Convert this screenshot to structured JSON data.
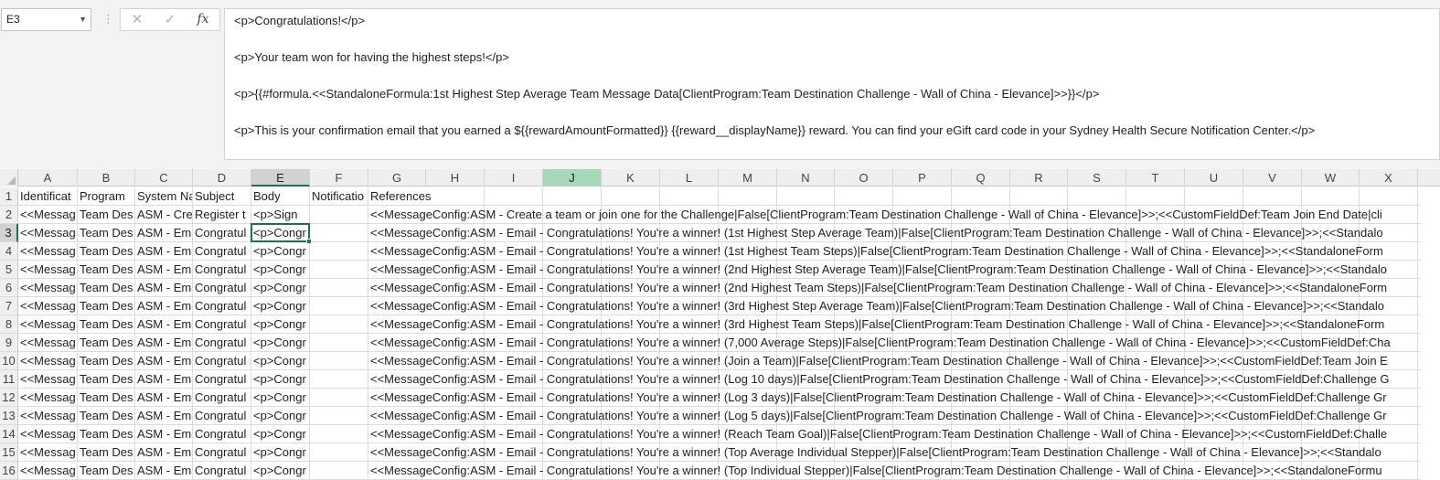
{
  "formula_bar": {
    "name_box": "E3",
    "fx_label": "fx",
    "cancel_icon": "close-icon",
    "enter_icon": "check-icon",
    "content_lines": [
      "<p>Congratulations!</p>",
      "",
      "<p>Your team won for having the highest steps!</p>",
      "",
      "<p>{{#formula.<<StandaloneFormula:1st Highest Step Average Team Message Data[ClientProgram:Team Destination Challenge - Wall of China - Elevance]>>}}</p>",
      "",
      "<p>This is your confirmation email that you earned a ${{rewardAmountFormatted}} {{reward__displayName}} reward. You can find your eGift card code in your Sydney Health Secure Notification Center.</p>"
    ]
  },
  "columns": [
    "A",
    "B",
    "C",
    "D",
    "E",
    "F",
    "G",
    "H",
    "I",
    "J",
    "K",
    "L",
    "M",
    "N",
    "O",
    "P",
    "Q",
    "R",
    "S",
    "T",
    "U",
    "V",
    "W",
    "X"
  ],
  "selected_column": "E",
  "highlighted_column": "J",
  "selected_row": "3",
  "rows": [
    {
      "num": "1",
      "A": "Identificat",
      "B": "Program",
      "C": "System Na",
      "D": "Subject",
      "E": "Body",
      "F": "Notificatio",
      "G": "References"
    },
    {
      "num": "2",
      "A": "<<Messag",
      "B": "Team Des",
      "C": "ASM - Cre",
      "D": "Register t",
      "E": "<p>Sign",
      "F": "",
      "G": "<<MessageConfig:ASM - Create a team or join one for the Challenge|False[ClientProgram:Team Destination Challenge - Wall of China - Elevance]>>;<<CustomFieldDef:Team Join End Date|cli"
    },
    {
      "num": "3",
      "A": "<<Messag",
      "B": "Team Des",
      "C": "ASM - Ema",
      "D": "Congratul",
      "E": "<p>Congr",
      "F": "",
      "G": "<<MessageConfig:ASM - Email - Congratulations! You're a winner! (1st Highest Step Average Team)|False[ClientProgram:Team Destination Challenge - Wall of China - Elevance]>>;<<Standalo"
    },
    {
      "num": "4",
      "A": "<<Messag",
      "B": "Team Des",
      "C": "ASM - Ema",
      "D": "Congratul",
      "E": "<p>Congr",
      "F": "",
      "G": "<<MessageConfig:ASM - Email - Congratulations! You're a winner! (1st Highest Team Steps)|False[ClientProgram:Team Destination Challenge - Wall of China - Elevance]>>;<<StandaloneForm"
    },
    {
      "num": "5",
      "A": "<<Messag",
      "B": "Team Des",
      "C": "ASM - Ema",
      "D": "Congratul",
      "E": "<p>Congr",
      "F": "",
      "G": "<<MessageConfig:ASM - Email - Congratulations! You're a winner! (2nd Highest Step Average Team)|False[ClientProgram:Team Destination Challenge - Wall of China - Elevance]>>;<<Standalo"
    },
    {
      "num": "6",
      "A": "<<Messag",
      "B": "Team Des",
      "C": "ASM - Ema",
      "D": "Congratul",
      "E": "<p>Congr",
      "F": "",
      "G": "<<MessageConfig:ASM - Email - Congratulations! You're a winner! (2nd Highest Team Steps)|False[ClientProgram:Team Destination Challenge - Wall of China - Elevance]>>;<<StandaloneForm"
    },
    {
      "num": "7",
      "A": "<<Messag",
      "B": "Team Des",
      "C": "ASM - Ema",
      "D": "Congratul",
      "E": "<p>Congr",
      "F": "",
      "G": "<<MessageConfig:ASM - Email - Congratulations! You're a winner! (3rd Highest Step Average Team)|False[ClientProgram:Team Destination Challenge - Wall of China - Elevance]>>;<<Standalo"
    },
    {
      "num": "8",
      "A": "<<Messag",
      "B": "Team Des",
      "C": "ASM - Ema",
      "D": "Congratul",
      "E": "<p>Congr",
      "F": "",
      "G": "<<MessageConfig:ASM - Email - Congratulations! You're a winner! (3rd Highest Team Steps)|False[ClientProgram:Team Destination Challenge - Wall of China - Elevance]>>;<<StandaloneForm"
    },
    {
      "num": "9",
      "A": "<<Messag",
      "B": "Team Des",
      "C": "ASM - Ema",
      "D": "Congratul",
      "E": "<p>Congr",
      "F": "",
      "G": "<<MessageConfig:ASM - Email - Congratulations! You're a winner! (7,000 Average Steps)|False[ClientProgram:Team Destination Challenge - Wall of China - Elevance]>>;<<CustomFieldDef:Cha"
    },
    {
      "num": "10",
      "A": "<<Messag",
      "B": "Team Des",
      "C": "ASM - Ema",
      "D": "Congratul",
      "E": "<p>Congr",
      "F": "",
      "G": "<<MessageConfig:ASM - Email - Congratulations! You're a winner! (Join a Team)|False[ClientProgram:Team Destination Challenge - Wall of China - Elevance]>>;<<CustomFieldDef:Team Join E"
    },
    {
      "num": "11",
      "A": "<<Messag",
      "B": "Team Des",
      "C": "ASM - Ema",
      "D": "Congratul",
      "E": "<p>Congr",
      "F": "",
      "G": "<<MessageConfig:ASM - Email - Congratulations! You're a winner! (Log 10 days)|False[ClientProgram:Team Destination Challenge - Wall of China - Elevance]>>;<<CustomFieldDef:Challenge G"
    },
    {
      "num": "12",
      "A": "<<Messag",
      "B": "Team Des",
      "C": "ASM - Ema",
      "D": "Congratul",
      "E": "<p>Congr",
      "F": "",
      "G": "<<MessageConfig:ASM - Email - Congratulations! You're a winner! (Log 3 days)|False[ClientProgram:Team Destination Challenge - Wall of China - Elevance]>>;<<CustomFieldDef:Challenge Gr"
    },
    {
      "num": "13",
      "A": "<<Messag",
      "B": "Team Des",
      "C": "ASM - Ema",
      "D": "Congratul",
      "E": "<p>Congr",
      "F": "",
      "G": "<<MessageConfig:ASM - Email - Congratulations! You're a winner! (Log 5 days)|False[ClientProgram:Team Destination Challenge - Wall of China - Elevance]>>;<<CustomFieldDef:Challenge Gr"
    },
    {
      "num": "14",
      "A": "<<Messag",
      "B": "Team Des",
      "C": "ASM - Ema",
      "D": "Congratul",
      "E": "<p>Congr",
      "F": "",
      "G": "<<MessageConfig:ASM - Email - Congratulations! You're a winner! (Reach Team Goal)|False[ClientProgram:Team Destination Challenge - Wall of China - Elevance]>>;<<CustomFieldDef:Challe"
    },
    {
      "num": "15",
      "A": "<<Messag",
      "B": "Team Des",
      "C": "ASM - Ema",
      "D": "Congratul",
      "E": "<p>Congr",
      "F": "",
      "G": "<<MessageConfig:ASM - Email - Congratulations! You're a winner! (Top Average Individual Stepper)|False[ClientProgram:Team Destination Challenge - Wall of China - Elevance]>>;<<Standalo"
    },
    {
      "num": "16",
      "A": "<<Messag",
      "B": "Team Des",
      "C": "ASM - Ema",
      "D": "Congratul",
      "E": "<p>Congr",
      "F": "",
      "G": "<<MessageConfig:ASM - Email - Congratulations! You're a winner! (Top Individual Stepper)|False[ClientProgram:Team Destination Challenge - Wall of China - Elevance]>>;<<StandaloneFormu"
    }
  ]
}
